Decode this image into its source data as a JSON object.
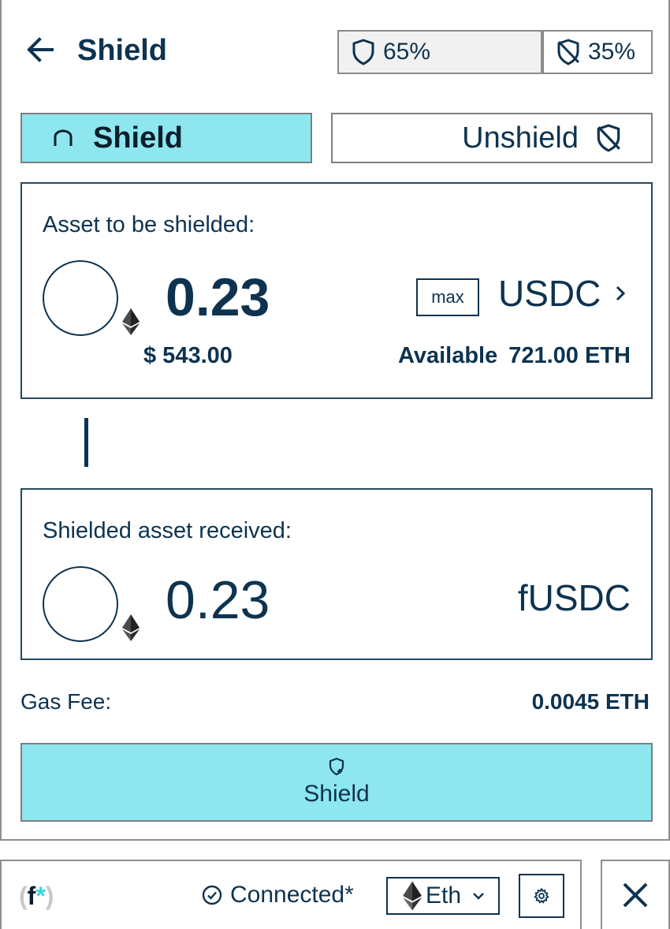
{
  "header": {
    "title": "Shield",
    "back_icon": "arrow-left-icon",
    "shielded_pct": "65%",
    "unshielded_pct": "35%"
  },
  "tabs": {
    "shield": "Shield",
    "unshield": "Unshield"
  },
  "from": {
    "label": "Asset to be shielded:",
    "amount": "0.23",
    "usd_value": "$ 543.00",
    "max_label": "max",
    "asset": "USDC",
    "available_label": "Available",
    "available_value": "721.00 ETH"
  },
  "to": {
    "label": "Shielded asset received:",
    "amount": "0.23",
    "asset": "fUSDC"
  },
  "fee": {
    "label": "Gas Fee:",
    "value": "0.0045 ETH"
  },
  "submit": {
    "label": "Shield",
    "icon": "shield-plus-icon"
  },
  "footer": {
    "logo_f": "f",
    "logo_star": "*",
    "logo_open": "(",
    "logo_close": ")",
    "status": "Connected*",
    "network": "Eth",
    "settings_icon": "gear-icon",
    "close_icon": "close-icon"
  },
  "colors": {
    "accent": "#8ee6ee",
    "text": "#0d3350",
    "logo_star": "#33d6e0"
  }
}
